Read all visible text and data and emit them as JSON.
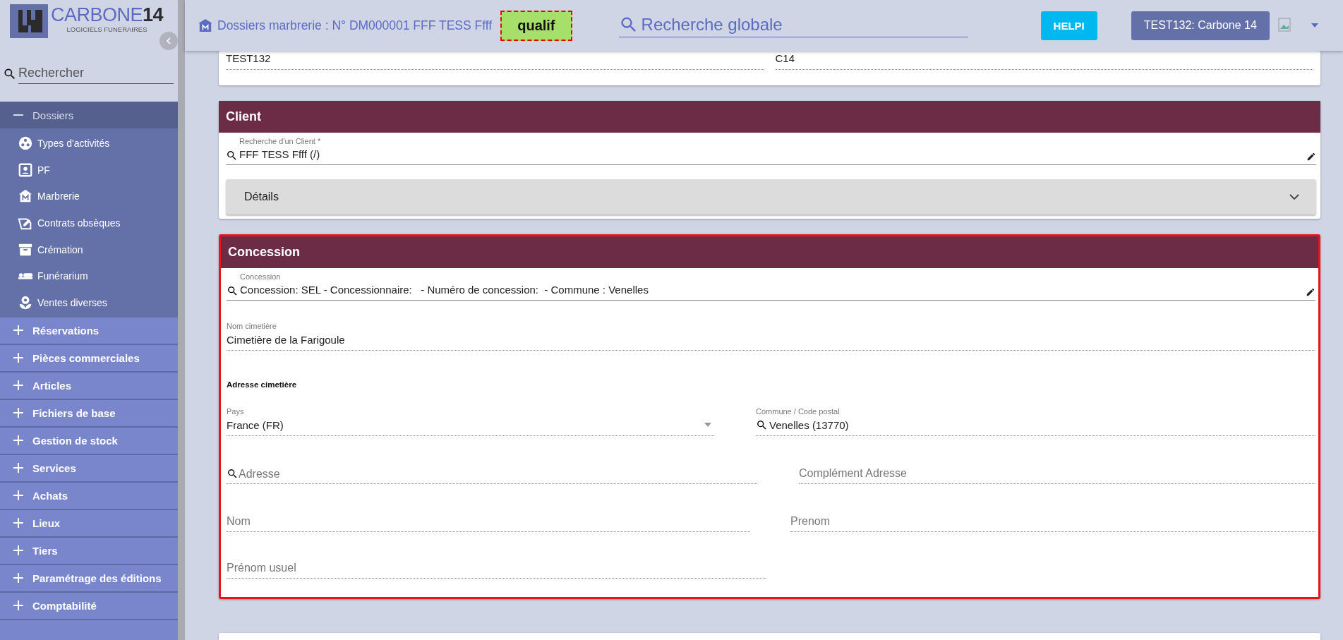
{
  "logo": {
    "name": "CARBONE",
    "number": "14",
    "tagline": "LOGICIELS FUNERAIRES"
  },
  "header": {
    "breadcrumb": "Dossiers marbrerie : N° DM000001 FFF TESS Ffff",
    "env_badge": "qualif",
    "search": {
      "placeholder": "Recherche globale"
    },
    "help_button": "HELPI",
    "account_button": "TEST132: Carbone 14"
  },
  "sidebar": {
    "search": {
      "placeholder": "Rechercher"
    },
    "items": [
      {
        "label": "Dossiers",
        "expanded": true,
        "children": [
          {
            "label": "Types d'activités"
          },
          {
            "label": "PF"
          },
          {
            "label": "Marbrerie"
          },
          {
            "label": "Contrats obsèques"
          },
          {
            "label": "Crémation"
          },
          {
            "label": "Funérarium"
          },
          {
            "label": "Ventes diverses"
          }
        ]
      },
      {
        "label": "Réservations",
        "expanded": false
      },
      {
        "label": "Pièces commerciales",
        "expanded": false
      },
      {
        "label": "Articles",
        "expanded": false
      },
      {
        "label": "Fichiers de base",
        "expanded": false
      },
      {
        "label": "Gestion de stock",
        "expanded": false
      },
      {
        "label": "Services",
        "expanded": false
      },
      {
        "label": "Achats",
        "expanded": false
      },
      {
        "label": "Lieux",
        "expanded": false
      },
      {
        "label": "Tiers",
        "expanded": false
      },
      {
        "label": "Paramétrage des éditions",
        "expanded": false
      },
      {
        "label": "Comptabilité",
        "expanded": false
      }
    ]
  },
  "top_card": {
    "fields": [
      {
        "value": "TEST132"
      },
      {
        "value": "C14"
      }
    ]
  },
  "client": {
    "title": "Client",
    "search_field": {
      "label": "Recherche d'un Client *",
      "value": "FFF TESS Ffff (/)"
    },
    "details": {
      "label": "Détails",
      "expanded": false
    }
  },
  "concession": {
    "title": "Concession",
    "highlighted": true,
    "search_field": {
      "label": "Concession",
      "value": "Concession: SEL - Concessionnaire:   - Numéro de concession:  - Commune : Venelles"
    },
    "cemetery_name": {
      "label": "Nom cimetière",
      "value": "Cimetière de la Farigoule"
    },
    "address_heading": "Adresse cimetière",
    "country": {
      "label": "Pays",
      "value": "France (FR)"
    },
    "town": {
      "label": "Commune / Code postal",
      "value": "Venelles (13770)"
    },
    "address": {
      "placeholder": "Adresse"
    },
    "address_extra": {
      "placeholder": "Complément Adresse"
    },
    "last_name": {
      "placeholder": "Nom"
    },
    "first_name": {
      "placeholder": "Prenom"
    },
    "usual_first_name": {
      "placeholder": "Prénom usuel"
    }
  }
}
